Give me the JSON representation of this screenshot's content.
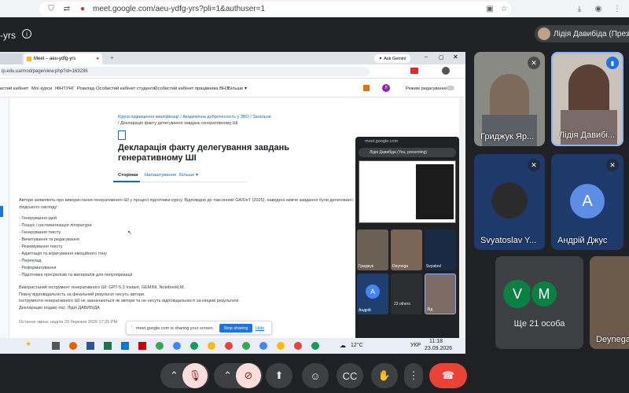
{
  "browser": {
    "url": "meet.google.com/aeu-ydfg-yrs?pli=1&authuser=1"
  },
  "meet": {
    "title_fragment": "-yrs",
    "presenter_chip": "Лідія Давибіда (Презе"
  },
  "shared": {
    "tab_active": "Meet – aeu-ydfg-yrs",
    "ask_gemini": "Ask Gemini",
    "page_url": "ip.edu.ua/mod/page/view.php?id=163236",
    "nav_items": [
      "истий кабінет",
      "Мої курси",
      "ІФНТУНГ",
      "Розклад",
      "Особистий кабінет студента",
      "Особистий кабінет працівника ВНЗ",
      "Більше ▾"
    ],
    "edit_mode": "Режим редагування",
    "breadcrumbs": "Курси підвищення кваліфікації / Академічна доброчесність у ЗВО / Загальне",
    "breadcrumb2": "/ Декларація факту делегування завдань генеративному ШІ",
    "heading": "Декларація факту делегування завдань генеративному ШІ",
    "tabs": [
      "Сторінка",
      "Налаштування",
      "Більше ▾"
    ],
    "intro": "Автори заявляють про використання генеративного ШІ у процесі  підготовки курсу. Відповідно до таксономії GAIDeT (2025), наведені нижче завдання були делеговані інстр",
    "intro2": "людського нагляду:",
    "list": [
      "- Генерування ідей",
      "- Пошук і систематизація літератури",
      "- Генерування тексту",
      "- Вичитування та редагування",
      "- Резюмування тексту",
      "- Адаптація та коригування емоційного тону",
      "- Переклад",
      "- Реформатування",
      "- Підготовка пресрелізів та матеріалів для популяризації"
    ],
    "footer_lines": [
      "Використаний інструмент генеративного ШІ: GPT-5.3 Instant, GEMINI, NotebookLM.",
      "Повну відповідальність за фінальний результат несуть автори.",
      "Інструменти генеративного ШІ не зазначаються як автори та не несуть відповідальності за кінцеві результати.",
      "Декларацію подав(-ла): Лідія ДАВИБІДА"
    ],
    "last_change": "Остання зміна: неділя 29 березня 2026 17:25 PM",
    "sharing_notice": "meet.google.com is sharing your screen.",
    "stop_sharing": "Stop sharing",
    "hide": "Hide",
    "weather": "12°C",
    "lang": "УКР",
    "time": "11:18",
    "date": "23.09.2026",
    "mini": {
      "url": "meet.google.com",
      "presenting": "Лідія Давибіда (You, presenting)",
      "others": "23 others",
      "n1": "Гриджук",
      "n2": "Deynega",
      "n3": "Svyatosl",
      "n4": "Андрій",
      "n5": "Лід"
    }
  },
  "tiles": [
    {
      "name": "Гриджук Яр...",
      "type": "photo",
      "mic_off": true
    },
    {
      "name": "Лідія Давибі...",
      "type": "photo",
      "speaking": true
    },
    {
      "name": "Svyatoslav Y...",
      "type": "avatar-photo",
      "mic_off": true
    },
    {
      "name": "Андрій Джус",
      "type": "letter",
      "letter": "A",
      "mic_off": true
    },
    {
      "name": "Ще 21 особа",
      "letters": [
        "V",
        "M"
      ]
    },
    {
      "name": "Deynega"
    }
  ],
  "colors": {
    "bg": "#202124",
    "tile": "#3c4043",
    "avatar_blue": "#1a73e8",
    "avatar_green": "#0b8043",
    "hangup": "#ea4335",
    "speaking": "#8ab4f8"
  }
}
